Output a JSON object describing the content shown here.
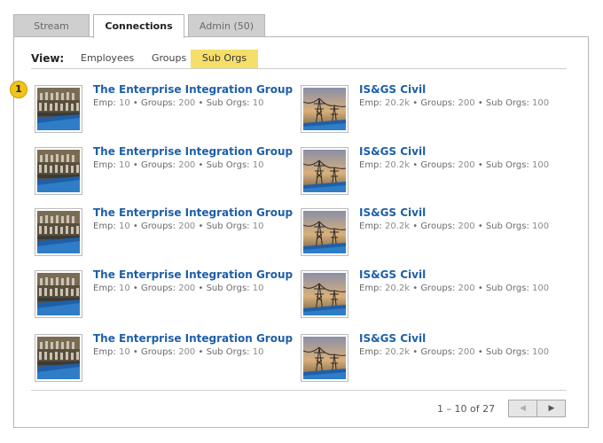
{
  "tabs": [
    {
      "label": "Stream"
    },
    {
      "label": "Connections"
    },
    {
      "label": "Admin (50)"
    }
  ],
  "view": {
    "label": "View:",
    "options": [
      "Employees",
      "Groups",
      "Sub Orgs"
    ],
    "selected": "Sub Orgs"
  },
  "badge": "1",
  "orgs": [
    {
      "name": "The Enterprise Integration Group",
      "emp": "10",
      "groups": "200",
      "suborgs": "10",
      "thumb": "integration-thumbnail"
    },
    {
      "name": "IS&GS Civil",
      "emp": "20.2k",
      "groups": "200",
      "suborgs": "100",
      "thumb": "power-lines-thumbnail"
    },
    {
      "name": "The Enterprise Integration Group",
      "emp": "10",
      "groups": "200",
      "suborgs": "10",
      "thumb": "integration-thumbnail"
    },
    {
      "name": "IS&GS Civil",
      "emp": "20.2k",
      "groups": "200",
      "suborgs": "100",
      "thumb": "power-lines-thumbnail"
    },
    {
      "name": "The Enterprise Integration Group",
      "emp": "10",
      "groups": "200",
      "suborgs": "10",
      "thumb": "integration-thumbnail"
    },
    {
      "name": "IS&GS Civil",
      "emp": "20.2k",
      "groups": "200",
      "suborgs": "100",
      "thumb": "power-lines-thumbnail"
    },
    {
      "name": "The Enterprise Integration Group",
      "emp": "10",
      "groups": "200",
      "suborgs": "10",
      "thumb": "integration-thumbnail"
    },
    {
      "name": "IS&GS Civil",
      "emp": "20.2k",
      "groups": "200",
      "suborgs": "100",
      "thumb": "power-lines-thumbnail"
    },
    {
      "name": "The Enterprise Integration Group",
      "emp": "10",
      "groups": "200",
      "suborgs": "10",
      "thumb": "integration-thumbnail"
    },
    {
      "name": "IS&GS Civil",
      "emp": "20.2k",
      "groups": "200",
      "suborgs": "100",
      "thumb": "power-lines-thumbnail"
    }
  ],
  "stat_labels": {
    "emp": "Emp:",
    "groups": "Groups:",
    "suborgs": "Sub Orgs:",
    "sep": "•"
  },
  "pager": {
    "text": "1 – 10 of 27",
    "prev": "◀",
    "next": "▶"
  },
  "colors": {
    "link": "#1f5fa8",
    "highlight": "#f6de6a",
    "badge": "#f0c419"
  }
}
